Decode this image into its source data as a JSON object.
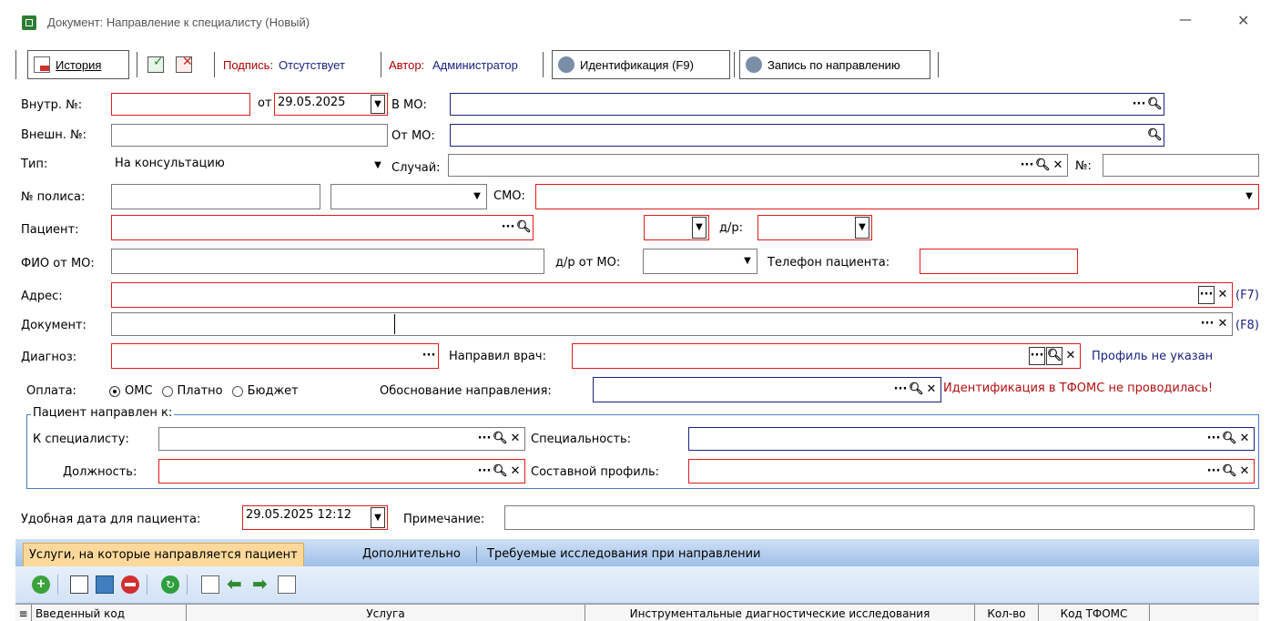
{
  "window": {
    "title": "Документ: Направление к специалисту (Новый)",
    "minimize": "—",
    "close": "✕"
  },
  "toolbar": {
    "history": "История",
    "signature_label": "Подпись:",
    "signature_value": "Отсутствует",
    "author_label": "Автор:",
    "author_value": "Администратор",
    "identification": "Идентификация (F9)",
    "appointment": "Запись по направлению"
  },
  "form": {
    "internal_no_label": "Внутр. №:",
    "internal_no": "",
    "from_label": "от",
    "date": "29.05.2025",
    "to_mo_label": "В МО:",
    "to_mo": "",
    "external_no_label": "Внешн. №:",
    "external_no": "",
    "from_mo_label": "От МО:",
    "from_mo": "",
    "type_label": "Тип:",
    "type_value": "На консультацию",
    "case_label": "Случай:",
    "case_value": "",
    "no_label": "№:",
    "no_value": "",
    "policy_label": "№ полиса:",
    "policy_no": "",
    "policy_type": "",
    "smo_label": "СМО:",
    "smo": "",
    "patient_label": "Пациент:",
    "patient": "",
    "gender": "",
    "dob_label": "д/р:",
    "dob": "",
    "fio_mo_label": "ФИО от МО:",
    "fio_mo": "",
    "dob_mo_label": "д/р от МО:",
    "dob_mo": "",
    "phone_label": "Телефон пациента:",
    "phone": "",
    "address_label": "Адрес:",
    "address": "",
    "address_hotkey": "(F7)",
    "document_label": "Документ:",
    "document": "",
    "document_hotkey": "(F8)",
    "diagnosis_label": "Диагноз:",
    "diagnosis": "",
    "doctor_label": "Направил врач:",
    "doctor": "",
    "profile_status": "Профиль не указан",
    "payment_label": "Оплата:",
    "payment_options": [
      "ОМС",
      "Платно",
      "Бюджет"
    ],
    "payment_selected": "ОМС",
    "reason_label": "Обоснование направления:",
    "reason": "",
    "tfoms_status": "Идентификация в ТФОМС не проводилась!"
  },
  "group": {
    "title": "Пациент направлен к:",
    "specialist_label": "К специалисту:",
    "specialist": "",
    "specialty_label": "Специальность:",
    "specialty": "",
    "position_label": "Должность:",
    "position": "",
    "compound_label": "Составной профиль:",
    "compound": ""
  },
  "footer": {
    "convenient_label": "Удобная дата для пациента:",
    "convenient_date": "29.05.2025 12:12",
    "note_label": "Примечание:",
    "note": ""
  },
  "tabs": [
    "Услуги, на которые направляется пациент",
    "Дополнительно",
    "Требуемые исследования при направлении"
  ],
  "grid": {
    "columns": [
      "Введенный код",
      "Услуга",
      "Инструментальные диагностические исследования",
      "Кол-во",
      "Код ТФОМС"
    ]
  },
  "colors": {
    "required_border": "#e01b1b",
    "optional_border": "#1a237e",
    "link": "#1a237e",
    "warning": "#b01010",
    "tab_active": "#fcd99b"
  }
}
